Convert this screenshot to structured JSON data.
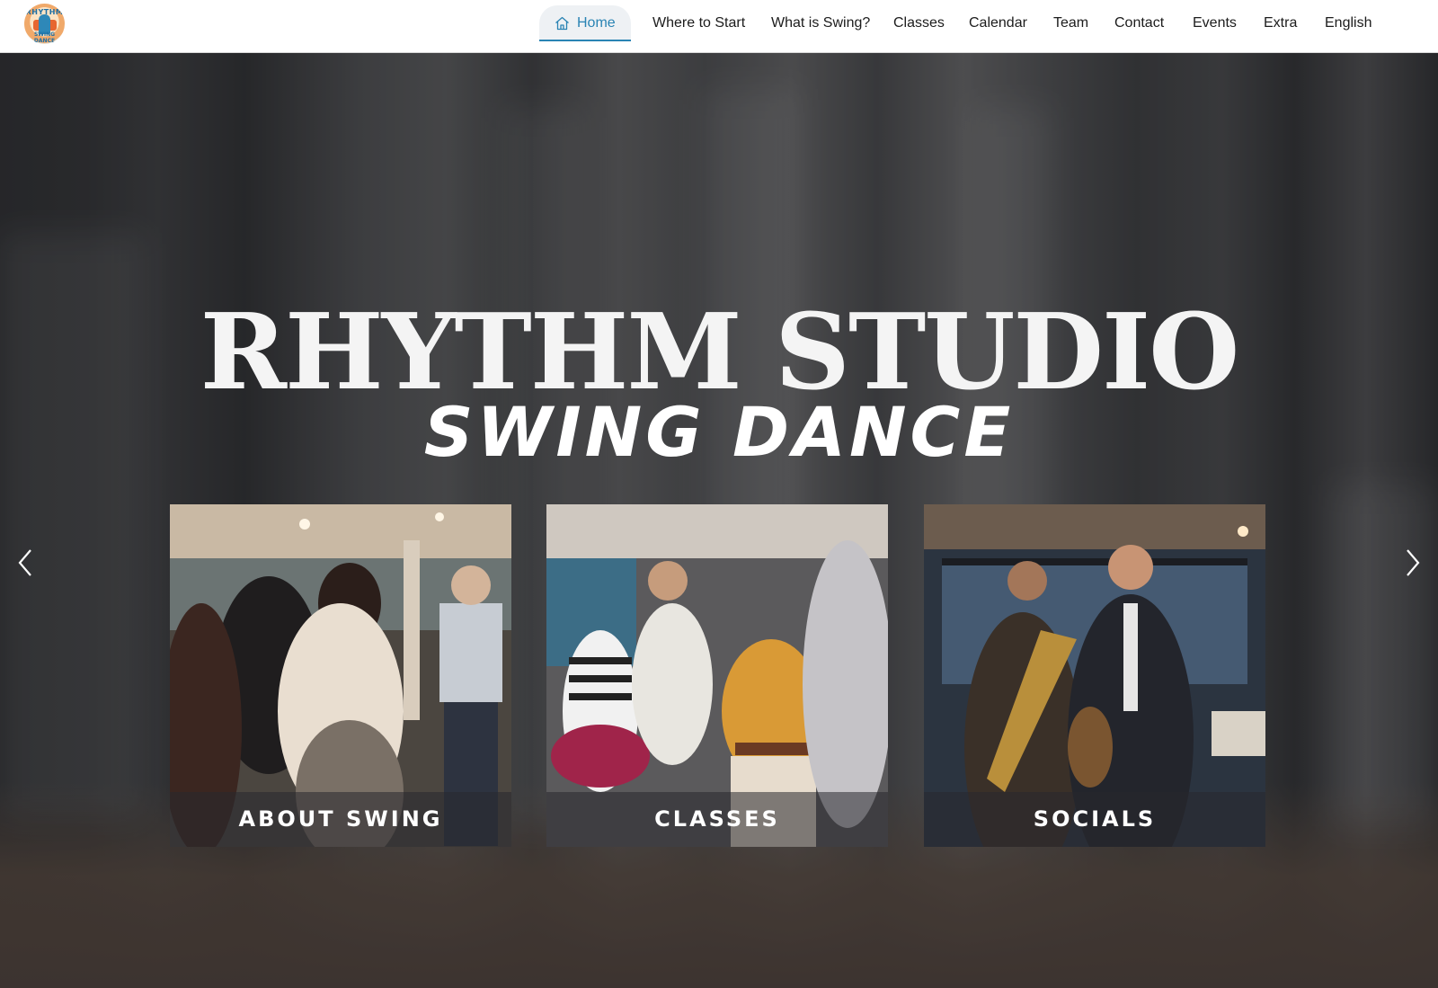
{
  "header": {
    "logo": {
      "text_top": "RHYTHM",
      "text_bottom": "SWING DANCE",
      "icon": "rhythm-studio-logo"
    },
    "nav": [
      {
        "label": "Home",
        "icon": "home-icon",
        "active": true
      },
      {
        "label": "Where to Start"
      },
      {
        "label": "What is Swing?"
      },
      {
        "label": "Classes"
      },
      {
        "label": "Calendar"
      },
      {
        "label": "Team"
      },
      {
        "label": "Contact"
      },
      {
        "label": "Events"
      },
      {
        "label": "Extra"
      },
      {
        "label": "English"
      }
    ]
  },
  "hero": {
    "title": "RHYTHM STUDIO",
    "subtitle": "SWING DANCE",
    "prev_icon": "chevron-left-icon",
    "next_icon": "chevron-right-icon",
    "cards": [
      {
        "label": "ABOUT SWING"
      },
      {
        "label": "CLASSES"
      },
      {
        "label": "SOCIALS"
      }
    ]
  },
  "colors": {
    "accent": "#2a84b4",
    "nav_text": "#1c1c1c",
    "active_tab_bg": "#eef1f4",
    "hero_text": "#f4f4f4"
  }
}
